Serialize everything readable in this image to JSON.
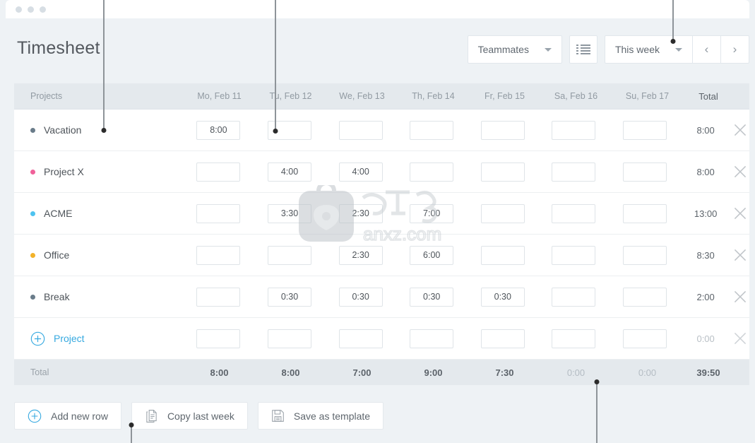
{
  "window": {
    "dots": 3
  },
  "header": {
    "title": "Timesheet",
    "teammates_label": "Teammates",
    "list_view_icon": "list-icon",
    "week_label": "This week",
    "prev_label": "‹",
    "next_label": "›"
  },
  "table": {
    "columns": [
      "Projects",
      "Mo, Feb 11",
      "Tu, Feb 12",
      "We, Feb 13",
      "Th, Feb 14",
      "Fr, Feb 15",
      "Sa, Feb 16",
      "Su, Feb 17",
      "Total"
    ],
    "rows": [
      {
        "name": "Vacation",
        "color": "#6a7c8a",
        "values": [
          "8:00",
          "",
          "",
          "",
          "",
          "",
          ""
        ],
        "total": "8:00"
      },
      {
        "name": "Project X",
        "color": "#f0619a",
        "values": [
          "",
          "4:00",
          "4:00",
          "",
          "",
          "",
          ""
        ],
        "total": "8:00"
      },
      {
        "name": "ACME",
        "color": "#4ec3f0",
        "values": [
          "",
          "3:30",
          "2:30",
          "7:00",
          "",
          "",
          ""
        ],
        "total": "13:00"
      },
      {
        "name": "Office",
        "color": "#f2b229",
        "values": [
          "",
          "",
          "2:30",
          "6:00",
          "",
          "",
          ""
        ],
        "total": "8:30"
      },
      {
        "name": "Break",
        "color": "#6a7c8a",
        "values": [
          "",
          "0:30",
          "0:30",
          "0:30",
          "0:30",
          "",
          ""
        ],
        "total": "2:00"
      }
    ],
    "add_row": {
      "label": "Project",
      "icon": "plus-circle-icon",
      "values": [
        "",
        "",
        "",
        "",
        "",
        "",
        ""
      ],
      "total": "0:00"
    },
    "totals": {
      "label": "Total",
      "values": [
        "8:00",
        "8:00",
        "7:00",
        "9:00",
        "7:30",
        "0:00",
        "0:00"
      ],
      "grand_total": "39:50"
    }
  },
  "footer": {
    "buttons": [
      {
        "label": "Add new row",
        "icon": "plus-circle-icon"
      },
      {
        "label": "Copy last week",
        "icon": "copy-document-icon"
      },
      {
        "label": "Save as template",
        "icon": "floppy-disk-icon"
      }
    ]
  },
  "colors": {
    "accent": "#36a9e0",
    "page_bg": "#eef2f5",
    "header_row_bg": "#e4e9ed",
    "text": "#4e545a"
  }
}
